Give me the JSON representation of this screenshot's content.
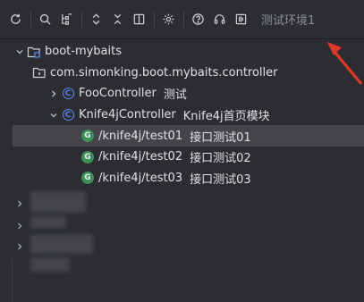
{
  "toolbar": {
    "buttons": [
      {
        "name": "refresh-icon"
      },
      {
        "name": "search-icon"
      },
      {
        "name": "filter-tree-icon"
      },
      {
        "name": "expand-all-icon"
      },
      {
        "name": "collapse-all-icon"
      },
      {
        "name": "split-view-icon"
      },
      {
        "name": "gear-icon"
      },
      {
        "name": "help-icon"
      },
      {
        "name": "headset-icon"
      },
      {
        "name": "equalizer-icon"
      }
    ],
    "environment_label": "测试环境1"
  },
  "tree": {
    "module": {
      "label": "boot-mybaits"
    },
    "package": {
      "label": "com.simonking.boot.mybaits.controller"
    },
    "controllers": [
      {
        "label": "FooController",
        "desc": "测试",
        "expanded": false
      },
      {
        "label": "Knife4jController",
        "desc": "Knife4j首页模块",
        "expanded": true
      }
    ],
    "endpoints": [
      {
        "method_badge": "G",
        "path": "/knife4j/test01",
        "desc": "接口测试01",
        "selected": true
      },
      {
        "method_badge": "G",
        "path": "/knife4j/test02",
        "desc": "接口测试02",
        "selected": false
      },
      {
        "method_badge": "G",
        "path": "/knife4j/test03",
        "desc": "接口测试03",
        "selected": false
      }
    ],
    "controller_badge": "C"
  },
  "colors": {
    "background": "#2b2d30",
    "selection": "#43454a",
    "controller_badge": "#548af7",
    "get_badge": "#3d8f58",
    "annotation_arrow": "#e0362c"
  }
}
